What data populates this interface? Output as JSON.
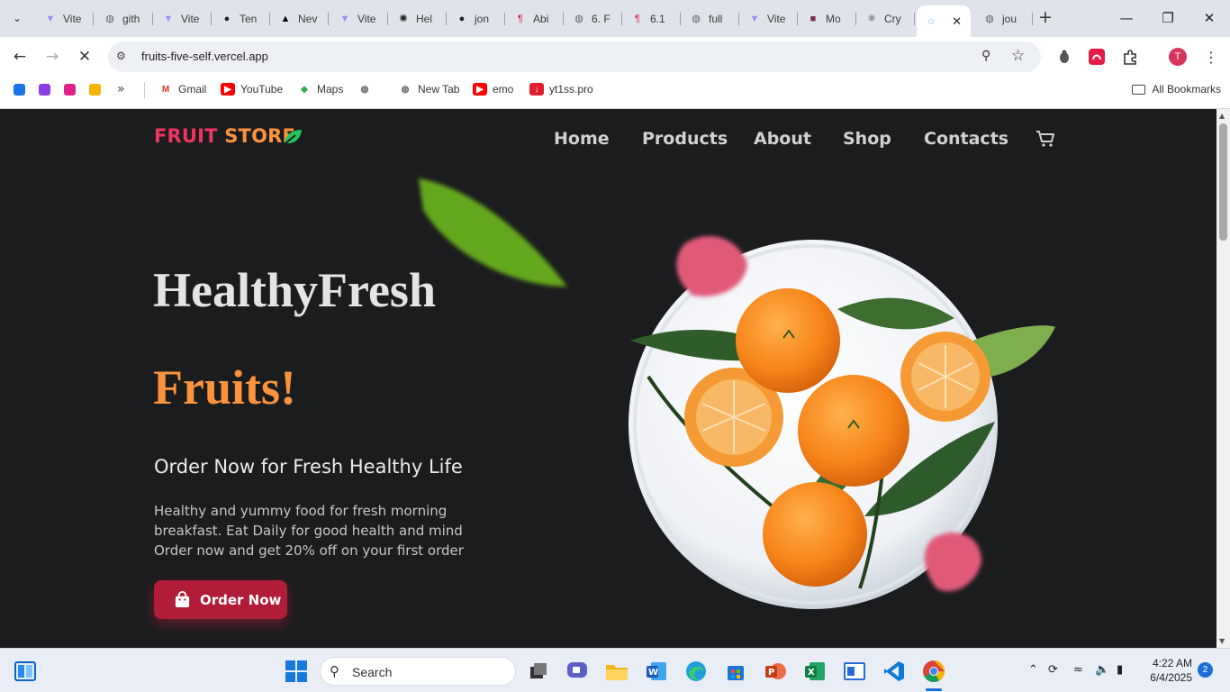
{
  "browser": {
    "tabs": [
      {
        "title": "Vite",
        "icon": "vite-icon",
        "color": "#a78bfa"
      },
      {
        "title": "gith",
        "icon": "globe-icon",
        "color": "#5f6368"
      },
      {
        "title": "Vite",
        "icon": "vite-icon",
        "color": "#a78bfa"
      },
      {
        "title": "Ten",
        "icon": "github-icon",
        "color": "#1f2328"
      },
      {
        "title": "Nev",
        "icon": "vercel-icon",
        "color": "#000000"
      },
      {
        "title": "Vite",
        "icon": "vite-icon",
        "color": "#a78bfa"
      },
      {
        "title": "Hel",
        "icon": "openai-icon",
        "color": "#1f1f1f"
      },
      {
        "title": "jon",
        "icon": "github-icon",
        "color": "#1f2328"
      },
      {
        "title": "Abi",
        "icon": "pdf-icon",
        "color": "#e11d48"
      },
      {
        "title": "6. F",
        "icon": "globe-icon",
        "color": "#5f6368"
      },
      {
        "title": "6.1",
        "icon": "pdf-icon",
        "color": "#e11d48"
      },
      {
        "title": "full",
        "icon": "globe-icon",
        "color": "#5f6368"
      },
      {
        "title": "Vite",
        "icon": "vite-icon",
        "color": "#a78bfa"
      },
      {
        "title": "Mo",
        "icon": "bookmark-app-icon",
        "color": "#7c2d5a"
      },
      {
        "title": "Cry",
        "icon": "react-icon",
        "color": "#0f172a"
      },
      {
        "title": "",
        "icon": "loading-icon",
        "color": "#1a73e8",
        "active": true
      },
      {
        "title": "jou",
        "icon": "globe-icon",
        "color": "#5f6368"
      }
    ],
    "url": "fruits-five-self.vercel.app",
    "profile_initial": "T",
    "bookmarks": [
      {
        "label": "Gmail",
        "icon": "gmail-icon"
      },
      {
        "label": "YouTube",
        "icon": "youtube-icon"
      },
      {
        "label": "Maps",
        "icon": "maps-icon"
      },
      {
        "label": "",
        "icon": "globe-icon"
      },
      {
        "label": "New Tab",
        "icon": "globe-icon"
      },
      {
        "label": "emo",
        "icon": "youtube-icon"
      },
      {
        "label": "yt1ss.pro",
        "icon": "download-icon"
      }
    ],
    "all_bookmarks": "All Bookmarks"
  },
  "site": {
    "brand_part1": "FRUIT",
    "brand_part2": "STORE",
    "nav": [
      "Home",
      "Products",
      "About",
      "Shop",
      "Contacts"
    ],
    "hero_line1": "HealthyFresh",
    "hero_line2": "Fruits!",
    "subtitle": "Order Now for Fresh Healthy Life",
    "description_lines": [
      "Healthy and yummy food for fresh morning",
      "breakfast. Eat Daily for good health and mind",
      "Order now and get 20% off on your first order"
    ],
    "order_button": "Order Now",
    "colors": {
      "brand_pink": "#ee3560",
      "accent_orange": "#fb923c",
      "button": "#b11c38",
      "background": "#1b1c1e"
    }
  },
  "taskbar": {
    "search_placeholder": "Search",
    "time": "4:22 AM",
    "date": "6/4/2025",
    "notifications": "2"
  }
}
